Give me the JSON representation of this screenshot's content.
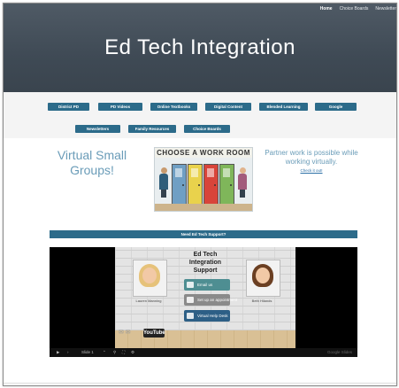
{
  "site": {
    "title": "Ed Tech Integration"
  },
  "top_nav": [
    {
      "label": "Home",
      "active": true
    },
    {
      "label": "Choice Boards",
      "active": false
    },
    {
      "label": "Newsletter",
      "active": false
    }
  ],
  "menu": {
    "row1": [
      "District PD",
      "PD Videos",
      "Online Textbooks",
      "Digital Content",
      "Blended Learning",
      "Google"
    ],
    "row2": [
      "Newsletters",
      "Family Resources",
      "Choice Boards"
    ]
  },
  "virtual": {
    "title": "Virtual Small Groups!",
    "image_banner": "CHOOSE A WORK ROOM",
    "partner_text": "Partner work is possible while working virtually.",
    "check_link": "Check it out!"
  },
  "support_bar": "Need Ed Tech Support?",
  "video": {
    "slide_title": "Ed Tech Integration Support",
    "left_name": "Lauren Manning",
    "right_name": "Beth Hilands",
    "buttons": [
      "Email us",
      "Set up an appointment",
      "Virtual Help Desk"
    ],
    "youtube_label": "YouTube",
    "slide_counter": "Slide 1",
    "brand": "Google Slides"
  },
  "colors": {
    "hero": "#434d58",
    "menu_button": "#2c6b8a",
    "accent_text": "#6a9cb8",
    "email_button": "#4e8e92",
    "appointment_button": "#8a8a8a",
    "helpdesk_button": "#2d5f86"
  }
}
